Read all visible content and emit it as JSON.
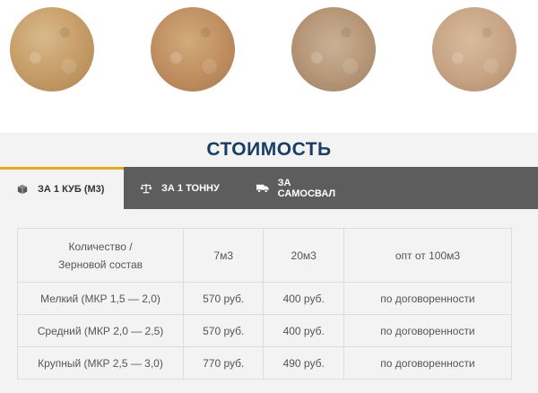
{
  "section": {
    "title": "СТОИМОСТЬ"
  },
  "tabs": [
    {
      "label": "ЗА 1 КУБ (М3)",
      "icon": "cube-icon",
      "active": true
    },
    {
      "label": "ЗА 1 ТОННУ",
      "icon": "scales-icon",
      "active": false
    },
    {
      "label": "ЗА САМОСВАЛ",
      "icon": "truck-icon",
      "active": false
    }
  ],
  "table": {
    "headers": {
      "col1_line1": "Количество /",
      "col1_line2": "Зерновой состав",
      "col2": "7м3",
      "col3": "20м3",
      "col4": "опт от 100м3"
    },
    "rows": [
      {
        "name": "Мелкий (МКР 1,5 — 2,0)",
        "p7": "570 руб.",
        "p20": "400 руб.",
        "p100": "по договоренности"
      },
      {
        "name": "Средний (МКР 2,0 — 2,5)",
        "p7": "570 руб.",
        "p20": "400 руб.",
        "p100": "по договоренности"
      },
      {
        "name": "Крупный (МКР 2,5 — 3,0)",
        "p7": "770 руб.",
        "p20": "490 руб.",
        "p100": "по договоренности"
      }
    ]
  },
  "colors": {
    "title": "#1a3d66",
    "tab_bar": "#5d5d5d",
    "tab_accent": "#e8a523"
  }
}
